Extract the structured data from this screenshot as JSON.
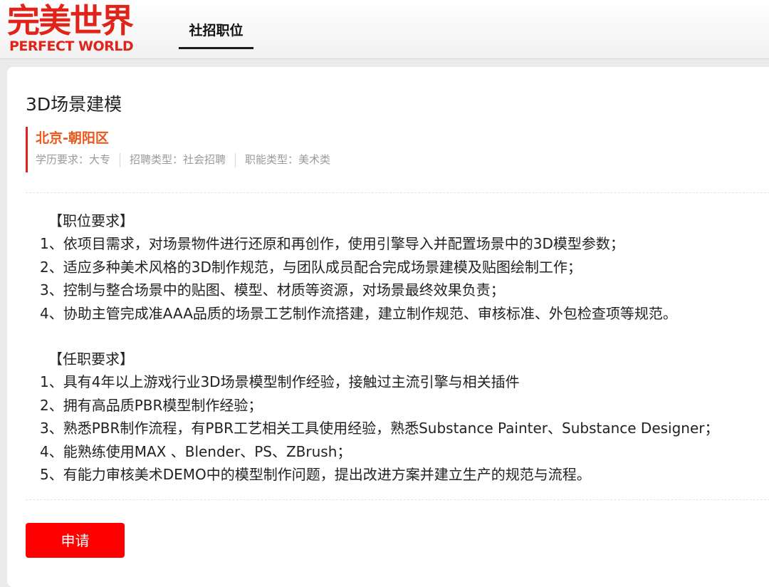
{
  "header": {
    "logo_cn": "完美世界",
    "logo_en": "PERFECT WORLD",
    "nav_tab": "社招职位"
  },
  "job": {
    "title": "3D场景建模",
    "location": "北京-朝阳区",
    "meta": {
      "education": "学历要求：大专",
      "recruit_type": "招聘类型：社会招聘",
      "function_type": "职能类型：美术类"
    },
    "responsibilities": {
      "heading": "【职位要求】",
      "items": [
        "1、依项目需求，对场景物件进行还原和再创作，使用引擎导入并配置场景中的3D模型参数；",
        "2、适应多种美术风格的3D制作规范，与团队成员配合完成场景建模及贴图绘制工作；",
        "3、控制与整合场景中的贴图、模型、材质等资源，对场景最终效果负责；",
        "4、协助主管完成准AAA品质的场景工艺制作流搭建，建立制作规范、审核标准、外包检查项等规范。"
      ]
    },
    "requirements": {
      "heading": "【任职要求】",
      "items": [
        "1、具有4年以上游戏行业3D场景模型制作经验，接触过主流引擎与相关插件",
        "2、拥有高品质PBR模型制作经验；",
        "3、熟悉PBR制作流程，有PBR工艺相关工具使用经验，熟悉Substance Painter、Substance Designer；",
        "4、能熟练使用MAX 、Blender、PS、ZBrush；",
        "5、有能力审核美术DEMO中的模型制作问题，提出改进方案并建立生产的规范与流程。"
      ]
    },
    "apply_label": "申请"
  },
  "colors": {
    "brand_red": "#e2231a",
    "location_orange": "#e8581a",
    "button_red": "#ff0000"
  }
}
